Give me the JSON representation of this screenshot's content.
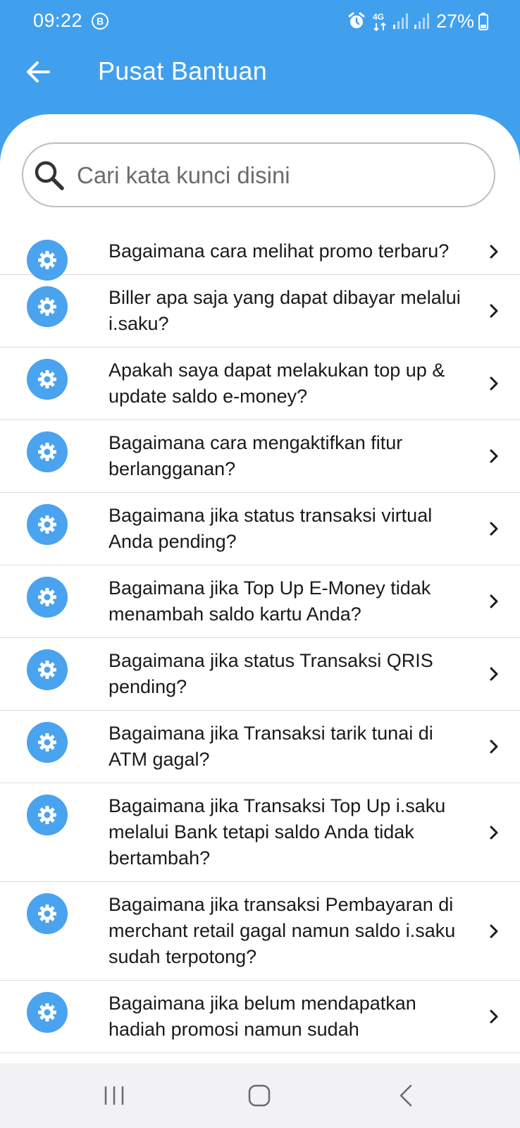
{
  "status_bar": {
    "time": "09:22",
    "notification_badge": "B",
    "network_type": "4G",
    "battery": "27%"
  },
  "header": {
    "title": "Pusat Bantuan"
  },
  "search": {
    "placeholder": "Cari kata kunci disini"
  },
  "faq": [
    {
      "question": "Bagaimana cara melihat promo terbaru?"
    },
    {
      "question": "Biller apa saja yang dapat dibayar melalui i.saku?"
    },
    {
      "question": "Apakah saya dapat melakukan top up & update saldo e-money?"
    },
    {
      "question": "Bagaimana cara mengaktifkan fitur berlangganan?"
    },
    {
      "question": "Bagaimana jika status transaksi virtual Anda pending?"
    },
    {
      "question": "Bagaimana jika Top Up E-Money tidak menambah saldo kartu Anda?"
    },
    {
      "question": "Bagaimana jika status Transaksi QRIS pending?"
    },
    {
      "question": "Bagaimana jika Transaksi tarik tunai di ATM gagal?"
    },
    {
      "question": "Bagaimana jika Transaksi Top Up i.saku melalui Bank tetapi saldo Anda tidak bertambah?"
    },
    {
      "question": "Bagaimana jika transaksi Pembayaran di merchant retail gagal namun saldo i.saku sudah terpotong?"
    },
    {
      "question": "Bagaimana jika belum mendapatkan hadiah promosi namun sudah"
    }
  ],
  "colors": {
    "primary": "#41a0ee",
    "icon_bg": "#4aa3ee",
    "background": "#ffffff"
  },
  "icons": {
    "back": "arrow-left-icon",
    "search": "magnifier-icon",
    "faq_item": "gear-icon",
    "faq_chevron": "chevron-right-icon"
  }
}
